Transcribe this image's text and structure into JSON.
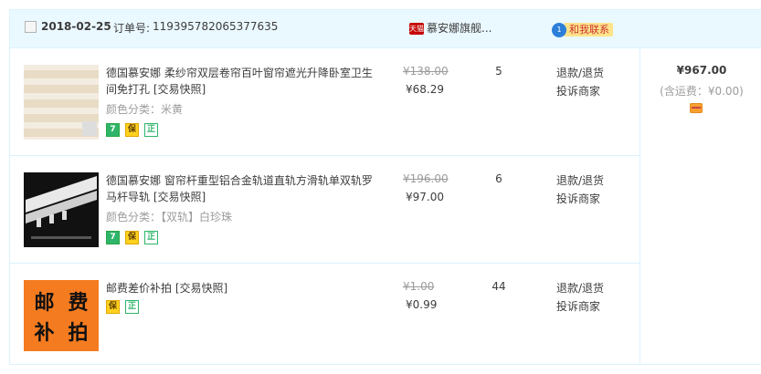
{
  "order": {
    "date": "2018-02-25",
    "order_no_label": "订单号:",
    "order_no": "119395782065377635",
    "shop_icon": "tmall-icon",
    "shop_badge": "天猫",
    "shop_name": "慕安娜旗舰...",
    "chat_count": "1",
    "chat_label": "和我联系",
    "total": "¥967.00",
    "shipping": "(含运费：¥0.00)"
  },
  "items": [
    {
      "title": "德国慕安娜 柔纱帘双层卷帘百叶窗帘遮光升降卧室卫生间免打孔",
      "snapshot": "[交易快照]",
      "spec": "颜色分类：米黄",
      "orig_price": "¥138.00",
      "price": "¥68.29",
      "qty": "5",
      "action_refund": "退款/退货",
      "action_complain": "投诉商家",
      "badges": [
        "7",
        "保",
        "正"
      ]
    },
    {
      "title": "德国慕安娜 窗帘杆重型铝合金轨道直轨方滑轨单双轨罗马杆导轨",
      "snapshot": "[交易快照]",
      "spec": "颜色分类：【双轨】白珍珠",
      "orig_price": "¥196.00",
      "price": "¥97.00",
      "qty": "6",
      "action_refund": "退款/退货",
      "action_complain": "投诉商家",
      "badges": [
        "7",
        "保",
        "正"
      ]
    },
    {
      "title": "邮费差价补拍",
      "snapshot": "[交易快照]",
      "spec": "",
      "orig_price": "¥1.00",
      "price": "¥0.99",
      "qty": "44",
      "action_refund": "退款/退货",
      "action_complain": "投诉商家",
      "badges": [
        "保",
        "正"
      ],
      "thumb_text": [
        "邮",
        "费",
        "补",
        "拍"
      ]
    }
  ]
}
